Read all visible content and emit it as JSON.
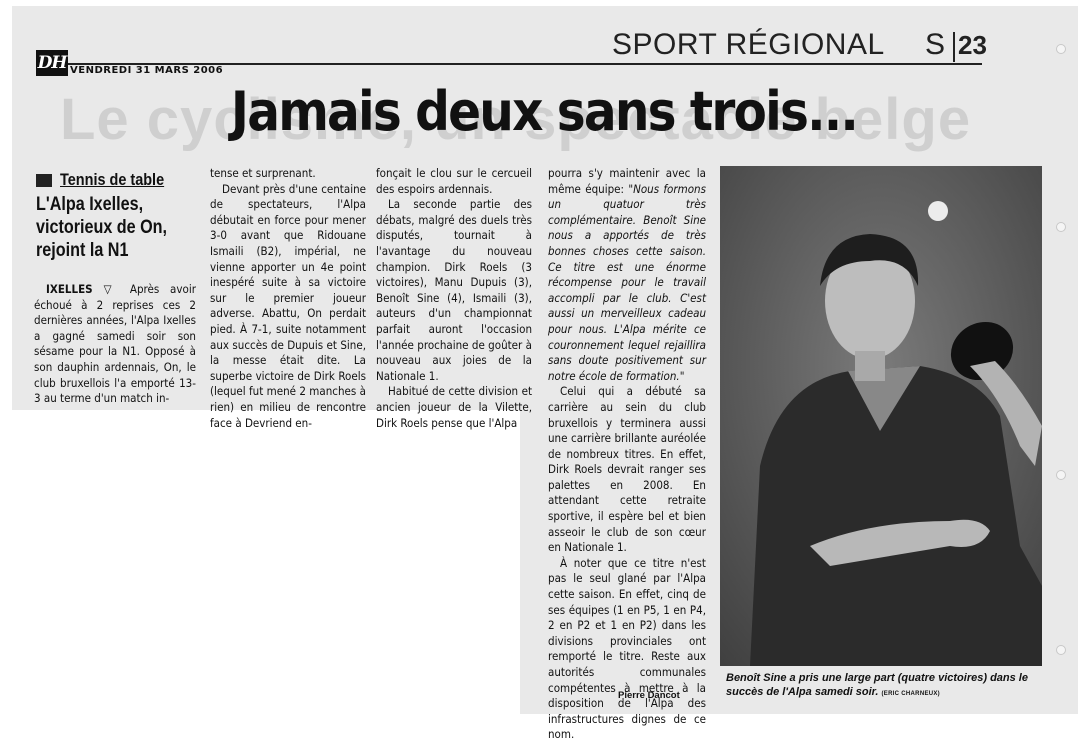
{
  "header": {
    "logo": "DH",
    "date": "VENDREDI 31 MARS 2006",
    "section": "SPORT RÉGIONAL",
    "section_letter": "S",
    "page_number": "23"
  },
  "article": {
    "headline": "Jamais deux sans trois...",
    "kicker": "Tennis de table",
    "subhead": "L'Alpa Ixelles, victorieux de On, rejoint la N1",
    "dateline": "IXELLES ▽",
    "col1_p1": "Après avoir échoué à 2 reprises ces 2 dernières années, l'Alpa Ixelles a gagné samedi soir son sésame pour la N1. Opposé à son dauphin ardennais, On, le club bruxellois l'a emporté 13-3 au terme d'un match in-",
    "col2_p1": "tense et surprenant.",
    "col2_p2": "Devant près d'une centaine de spectateurs, l'Alpa débutait en force pour mener 3-0 avant que Ridouane Ismaili (B2), impérial, ne vienne apporter un 4e point inespéré suite à sa victoire sur le premier joueur adverse. Abattu, On perdait pied. À 7-1, suite notamment aux succès de Dupuis et Sine, la messe était dite. La superbe victoire de Dirk Roels (lequel fut mené 2 manches à rien) en milieu de rencontre face à Devriend en-",
    "col3_p1": "fonçait le clou sur le cercueil des espoirs ardennais.",
    "col3_p2": "La seconde partie des débats, malgré des duels très disputés, tournait à l'avantage du nouveau champion. Dirk Roels (3 victoires), Manu Dupuis (3), Benoît Sine (4), Ismaili (3), auteurs d'un championnat parfait auront l'occasion l'année prochaine de goûter à nouveau aux joies de la Nationale 1.",
    "col3_p3": "Habitué de cette division et ancien joueur de la Vilette, Dirk Roels pense que l'Alpa",
    "col4_p1": "pourra s'y maintenir avec la même équipe:",
    "col4_quote": "\"Nous formons un quatuor très complémentaire. Benoît Sine nous a apportés de très bonnes choses cette saison. Ce titre est une énorme récompense pour le travail accompli par le club. C'est aussi un merveilleux cadeau pour nous. L'Alpa mérite ce couronnement lequel rejaillira sans doute positivement sur notre école de formation.\"",
    "col4_p2": "Celui qui a débuté sa carrière au sein du club bruxellois y terminera aussi une carrière brillante auréolée de nombreux titres. En effet, Dirk Roels devrait ranger ses palettes en 2008. En attendant cette retraite sportive, il espère bel et bien asseoir le club de son cœur en Nationale 1.",
    "col4_p3": "À noter que ce titre n'est pas le seul glané par l'Alpa cette saison. En effet, cinq de ses équipes (1 en P5, 1 en P4, 2 en P2 et 1 en P2) dans les divisions provinciales ont remporté le titre. Reste aux autorités communales compétentes à mettre à la disposition de l'Alpa des infrastructures dignes de ce nom.",
    "byline": "Pierre Dancot",
    "caption": "Benoît Sine a pris une large part (quatre victoires) dans le succès de l'Alpa samedi soir.",
    "photo_credit": "(ERIC CHARNEUX)"
  },
  "background_ghost_text": "Le cyclisme, un spectacle belge"
}
